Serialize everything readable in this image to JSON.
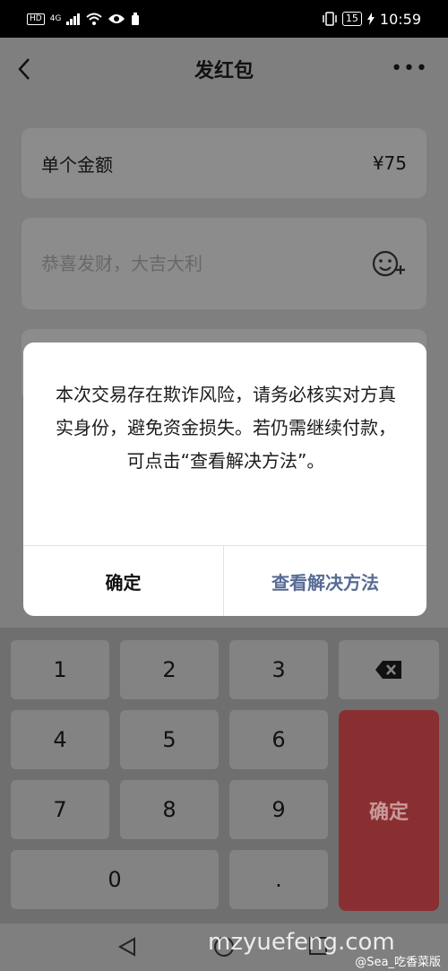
{
  "status_bar": {
    "hd": "HD",
    "network": "4G",
    "battery": "15",
    "time": "10:59"
  },
  "header": {
    "title": "发红包"
  },
  "amount": {
    "label": "单个金额",
    "value": "¥75"
  },
  "greeting": {
    "placeholder": "恭喜发财，大吉大利"
  },
  "dialog": {
    "message": "本次交易存在欺诈风险，请务必核实对方真实身份，避免资金损失。若仍需继续付款，可点击“查看解决方法”。",
    "confirm_label": "确定",
    "solution_label": "查看解决方法"
  },
  "keypad": {
    "keys": [
      "1",
      "2",
      "3",
      "4",
      "5",
      "6",
      "7",
      "8",
      "9",
      "0",
      "."
    ],
    "confirm_label": "确定",
    "accent_color": "#8a2f31"
  },
  "watermark": "mzyuefeng.com",
  "credit": "@Sea_吃香菜版",
  "colors": {
    "link": "#576b95",
    "overlay": "#7f7f7f"
  }
}
